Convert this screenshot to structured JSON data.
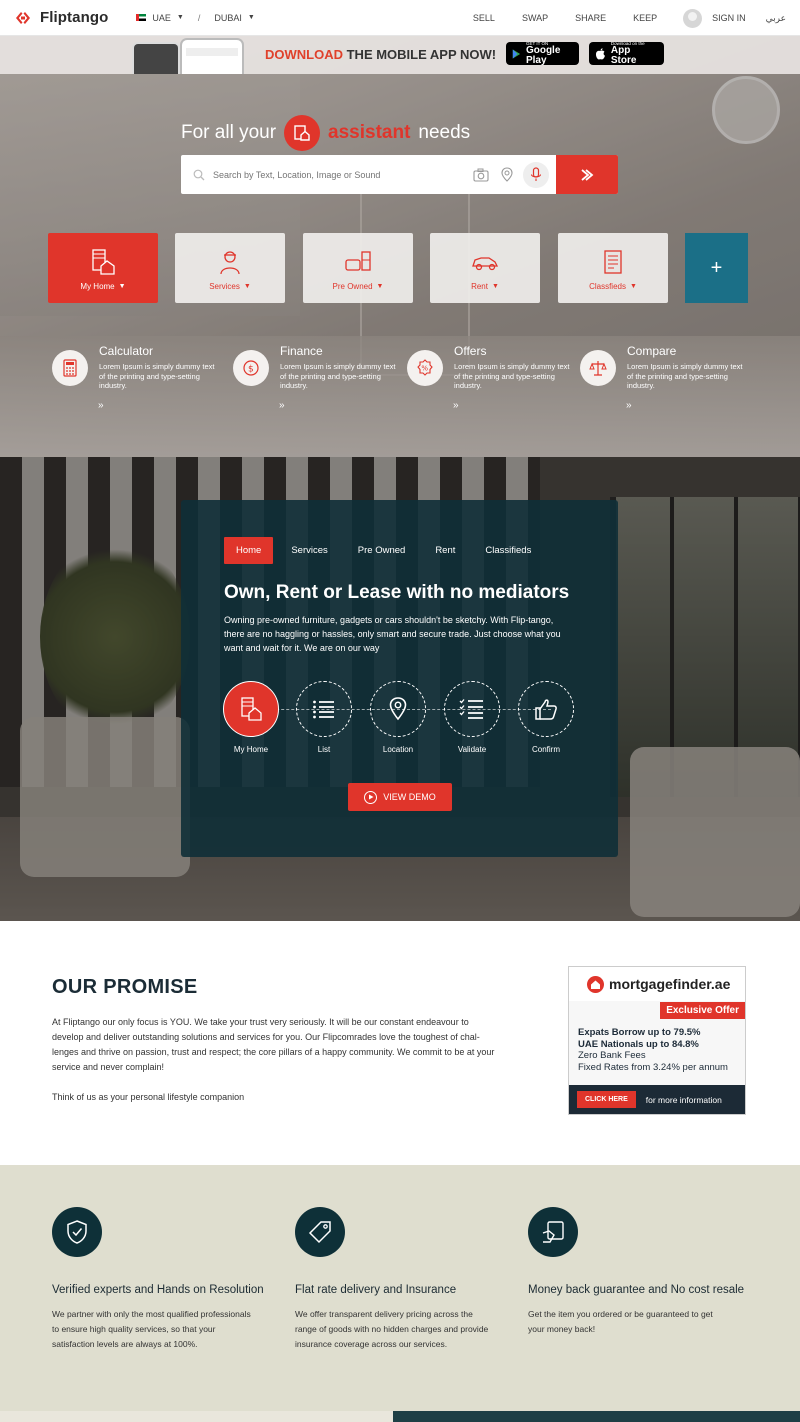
{
  "header": {
    "brand": "Fliptango",
    "country": "UAE",
    "separator": "/",
    "city": "DUBAI",
    "nav": [
      "SELL",
      "SWAP",
      "SHARE",
      "KEEP"
    ],
    "sign_in": "SIGN IN",
    "arabic": "عربي"
  },
  "app_banner": {
    "prefix": "DOWNLOAD",
    "text": " THE MOBILE APP NOW!",
    "google_small": "GET IT ON",
    "google_big": "Google Play",
    "apple_small": "Download on the",
    "apple_big": "App Store"
  },
  "hero": {
    "title_before": "For all your",
    "title_accent": "assistant",
    "title_after": "needs",
    "search_placeholder": "Search by Text, Location, Image or Sound",
    "categories": [
      "My Home",
      "Services",
      "Pre Owned",
      "Rent",
      "Classfieds"
    ],
    "plus": "+",
    "tools": [
      {
        "title": "Calculator",
        "desc": "Lorem Ipsum is simply dummy text of the printing and type-setting industry.",
        "arrow": "»"
      },
      {
        "title": "Finance",
        "desc": "Lorem Ipsum is simply dummy text of the printing and type-setting industry.",
        "arrow": "»"
      },
      {
        "title": "Offers",
        "desc": "Lorem Ipsum is simply dummy text of the printing and type-setting industry.",
        "arrow": "»"
      },
      {
        "title": "Compare",
        "desc": "Lorem Ipsum is simply dummy text of the printing and type-setting industry.",
        "arrow": "»"
      }
    ]
  },
  "panel": {
    "tabs": [
      "Home",
      "Services",
      "Pre Owned",
      "Rent",
      "Classifieds"
    ],
    "heading": "Own, Rent or Lease with no mediators",
    "paragraph": "Owning pre-owned furniture, gadgets or cars shouldn't be sketchy. With Flip-tango, there are no haggling or hassles, only smart and secure trade. Just choose what you want and wait for it. We are on our way",
    "steps": [
      "My Home",
      "List",
      "Location",
      "Validate",
      "Confirm"
    ],
    "demo_label": "VIEW DEMO"
  },
  "promise": {
    "heading": "OUR PROMISE",
    "text": "At Fliptango our only focus is YOU. We take your trust very seriously. It will be our constant endeavour to develop and deliver outstanding solutions and services for you. Our Flipcomrades love the toughest of chal-lenges and thrive on passion, trust and respect; the core pillars of a happy community. We commit to be at your service and never complain!",
    "text2": "Think of us as your personal lifestyle companion"
  },
  "ad": {
    "brand": "mortgagefinder.ae",
    "offer": "Exclusive Offer",
    "line1": "Expats Borrow up to 79.5%",
    "line2": "UAE Nationals up to 84.8%",
    "line3": "Zero Bank Fees",
    "line4": "Fixed Rates from 3.24% per annum",
    "cta": "CLICK HERE",
    "more": "for more information"
  },
  "features": [
    {
      "title": "Verified experts and Hands on Resolution",
      "desc": "We partner with only the most qualified professionals to ensure high quality services, so that your satisfaction levels are always at 100%."
    },
    {
      "title": "Flat rate delivery and Insurance",
      "desc": "We offer transparent delivery pricing across the range of goods with no hidden charges and provide insurance coverage across our services."
    },
    {
      "title": "Money back guarantee and No cost resale",
      "desc": "Get the item you ordered or be guaranteed to get your money back!"
    }
  ],
  "colors": {
    "accent": "#e0352b",
    "teal": "#1b6f87",
    "dark": "#0e3038"
  }
}
